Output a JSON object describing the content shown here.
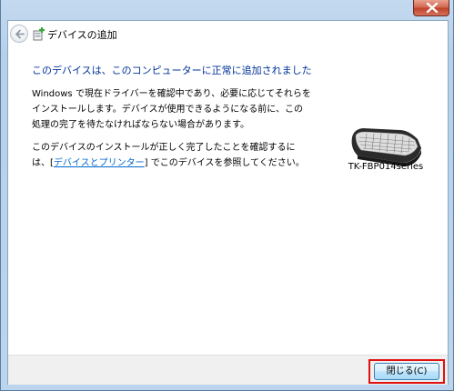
{
  "window": {
    "title": "デバイスの追加",
    "close_icon": "close-icon"
  },
  "header": {
    "back_icon": "back-arrow-icon",
    "wizard_icon": "device-wizard-icon",
    "title": "デバイスの追加"
  },
  "main": {
    "instruction": "このデバイスは、このコンピューターに正常に追加されました",
    "para1_line1": "Windows で現在ドライバーを確認中であり、必要に応じてそれらを",
    "para1_line2": "インストールします。デバイスが使用できるようになる前に、この",
    "para1_line3": "処理の完了を待たなければならない場合があります。",
    "para2_line1": "このデバイスのインストールが正しく完了したことを確認するに",
    "para2_prefix": "は、[",
    "para2_link": "デバイスとプリンター",
    "para2_suffix": "] でこのデバイスを参照してください。"
  },
  "device": {
    "icon": "keyboard-icon",
    "name": "TK-FBP014series"
  },
  "footer": {
    "close_label": "閉じる(C)"
  },
  "colors": {
    "instruction": "#003399",
    "link": "#0066cc",
    "highlight": "#e01010"
  }
}
